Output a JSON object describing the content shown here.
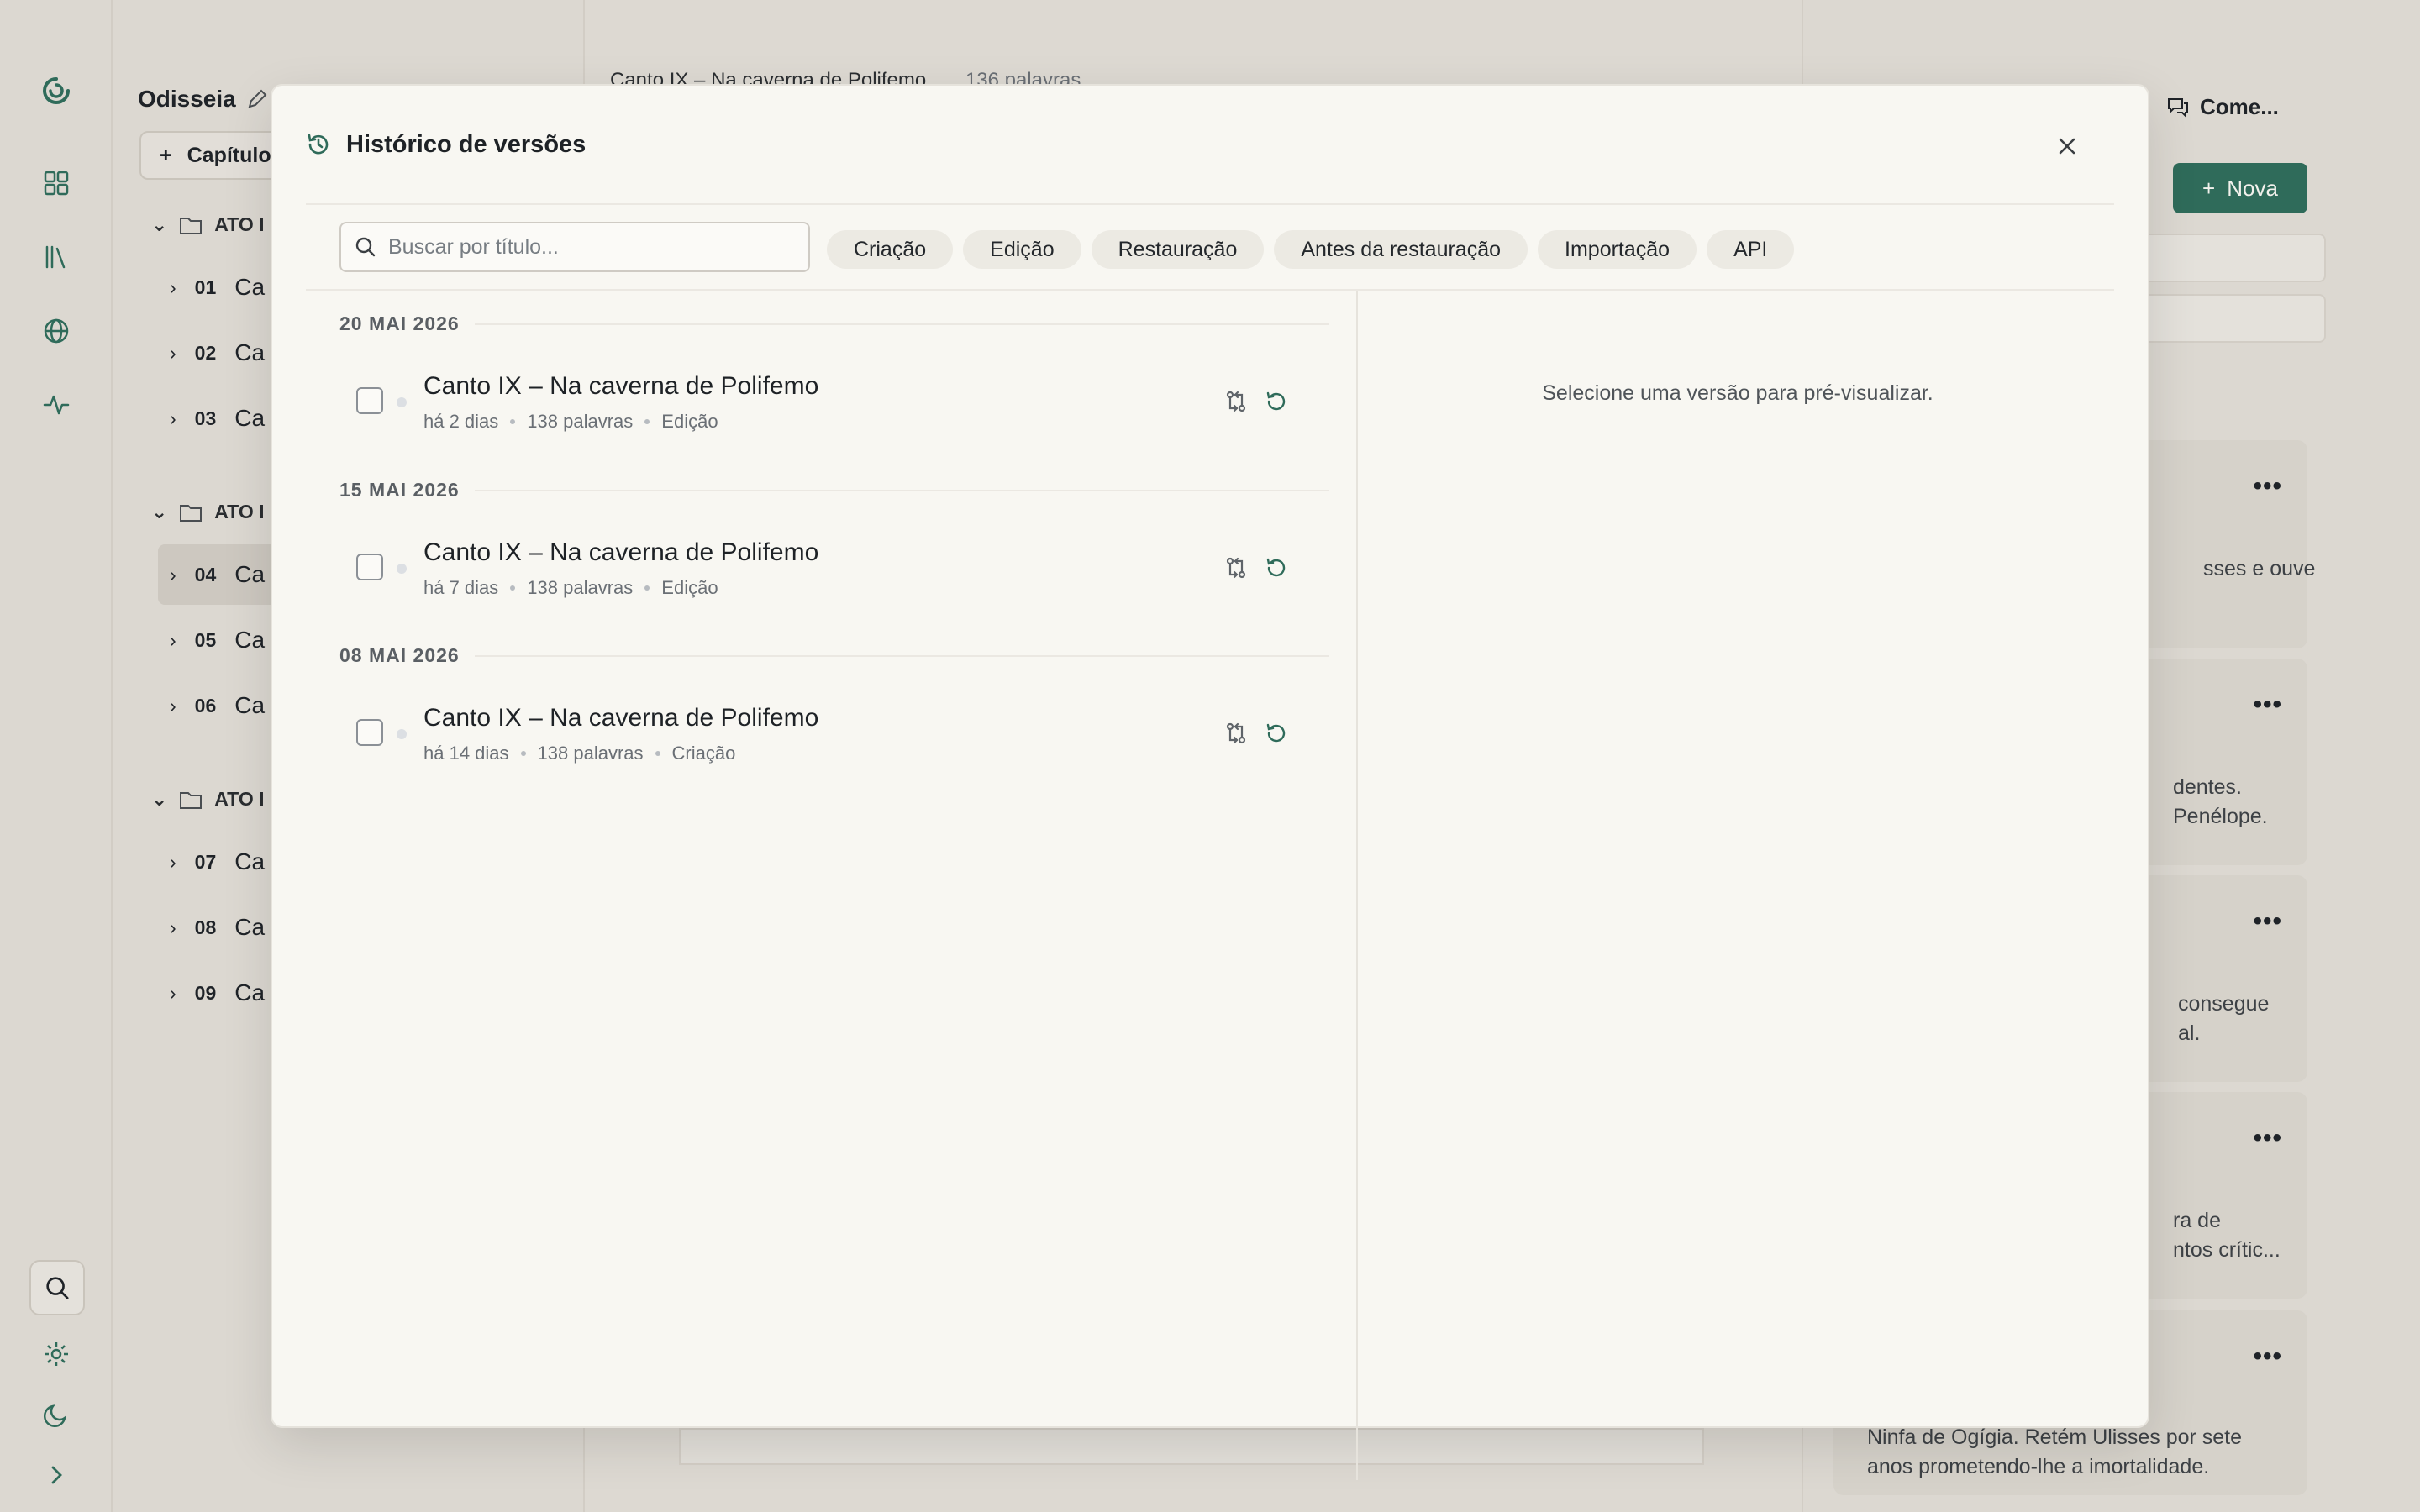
{
  "background": {
    "project_title": "Odisseia",
    "new_chapter_label": "Capítulo",
    "acts": [
      {
        "label": "ATO I",
        "chapters": [
          {
            "num": "01",
            "name": "Ca"
          },
          {
            "num": "02",
            "name": "Ca"
          },
          {
            "num": "03",
            "name": "Ca"
          }
        ]
      },
      {
        "label": "ATO I",
        "chapters": [
          {
            "num": "04",
            "name": "Ca"
          },
          {
            "num": "05",
            "name": "Ca"
          },
          {
            "num": "06",
            "name": "Ca"
          }
        ]
      },
      {
        "label": "ATO I",
        "chapters": [
          {
            "num": "07",
            "name": "Ca"
          },
          {
            "num": "08",
            "name": "Ca"
          },
          {
            "num": "09",
            "name": "Ca"
          }
        ]
      }
    ],
    "editor_header": "Canto IX – Na caverna de Polifemo",
    "editor_word_count": "136 palavras",
    "comments_tab": "Come...",
    "new_button": "Nova",
    "cards": [
      {
        "text": "sses e ouve"
      },
      {
        "text": "dentes.\nPenélope."
      },
      {
        "text": "consegue\nal."
      },
      {
        "text": "ra de\nntos crític..."
      },
      {
        "text": "Ninfa de Ogígia. Retém Ulisses por sete\nanos prometendo-lhe a imortalidade."
      }
    ]
  },
  "modal": {
    "title": "Histórico de versões",
    "search_placeholder": "Buscar por título...",
    "filters": [
      "Criação",
      "Edição",
      "Restauração",
      "Antes da restauração",
      "Importação",
      "API"
    ],
    "groups": [
      {
        "date": "20 MAI 2026",
        "entries": [
          {
            "title": "Canto IX – Na caverna de Polifemo",
            "ago": "há 2 dias",
            "words": "138 palavras",
            "kind": "Edição"
          }
        ]
      },
      {
        "date": "15 MAI 2026",
        "entries": [
          {
            "title": "Canto IX – Na caverna de Polifemo",
            "ago": "há 7 dias",
            "words": "138 palavras",
            "kind": "Edição"
          }
        ]
      },
      {
        "date": "08 MAI 2026",
        "entries": [
          {
            "title": "Canto IX – Na caverna de Polifemo",
            "ago": "há 14 dias",
            "words": "138 palavras",
            "kind": "Criação"
          }
        ]
      }
    ],
    "preview_empty": "Selecione uma versão para pré-visualizar."
  },
  "colors": {
    "accent": "#2f6b5a",
    "modal_bg": "#f8f7f2",
    "chip_bg": "#eceae3"
  }
}
